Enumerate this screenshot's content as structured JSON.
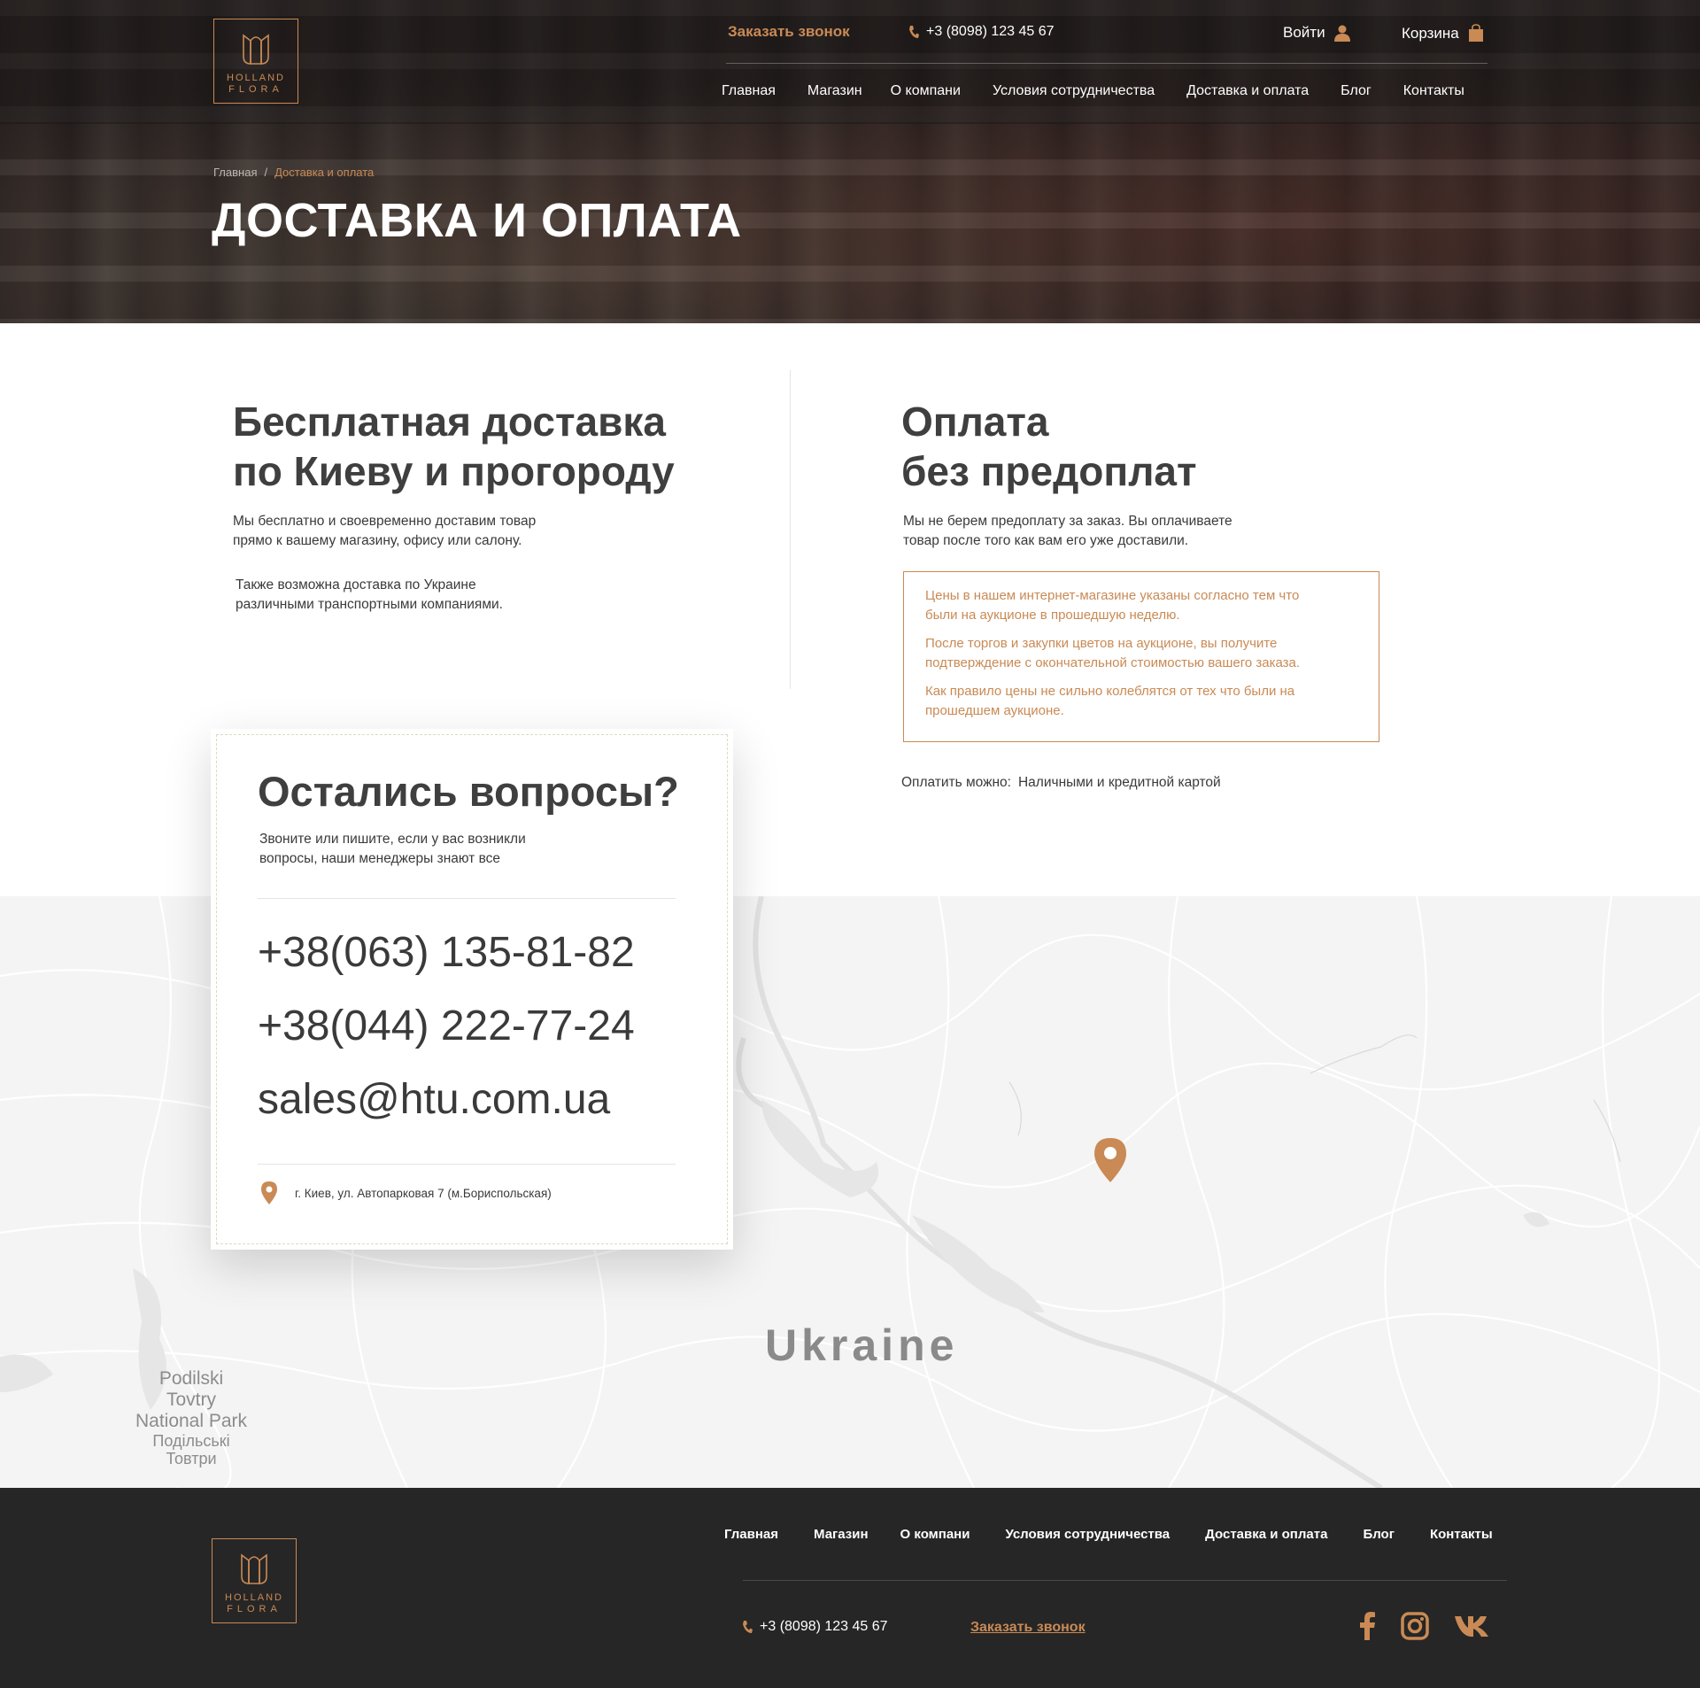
{
  "brand": {
    "line1": "HOLLAND",
    "line2": "FLORA",
    "accent": "#c98a55",
    "dark": "#262626"
  },
  "header": {
    "callback": "Заказать звонок",
    "phone": "+3 (8098) 123 45 67",
    "login": "Войти",
    "cart": "Корзина",
    "nav": [
      "Главная",
      "Магазин",
      "О компани",
      "Условия сотрудничества",
      "Доставка и оплата",
      "Блог",
      "Контакты"
    ]
  },
  "breadcrumb": {
    "home": "Главная",
    "separator": "/",
    "current": "Доставка и оплата"
  },
  "page_title": "ДОСТАВКА И ОПЛАТА",
  "delivery": {
    "title_line1": "Бесплатная доставка",
    "title_line2": "по Киеву и прогороду",
    "text1_line1": "Мы бесплатно и своевременно доставим товар",
    "text1_line2": "прямо к вашему магазину, офису или салону.",
    "text2_line1": "Также возможна доставка по Украине",
    "text2_line2": "различными транспортными компаниями."
  },
  "payment": {
    "title_line1": "Оплата",
    "title_line2": "без предоплат",
    "text_line1": "Мы не берем предоплату за заказ. Вы оплачиваете",
    "text_line2": "товар после того как вам его уже доставили.",
    "notes": [
      {
        "l1": "Цены в нашем интернет-магазине указаны согласно тем что",
        "l2": "были на аукционе в прошедшую неделю."
      },
      {
        "l1": "После торгов и закупки цветов на аукционе, вы получите",
        "l2": "подтверждение с окончательной стоимостью вашего заказа."
      },
      {
        "l1": "Как правило цены не сильно колеблятся от тех  что были на",
        "l2": "прошедшем аукционе."
      }
    ],
    "pay_label": "Оплатить можно:",
    "pay_methods": "Наличными и кредитной картой"
  },
  "contact_card": {
    "title": "Остались вопросы?",
    "sub_line1": "Звоните или пишите,  если у вас возникли",
    "sub_line2": "вопросы, наши менеджеры знают все",
    "phone1": "+38(063) 135-81-82",
    "phone2": "+38(044) 222-77-24",
    "email": "sales@htu.com.ua",
    "address": "г. Киев, ул. Автопарковая 7 (м.Бориспольская)"
  },
  "map": {
    "country": "Ukraine",
    "park_line1": "Podilski",
    "park_line2": "Tovtry",
    "park_line3": "National Park",
    "park_ua1": "Подільські",
    "park_ua2": "Товтри"
  },
  "footer": {
    "nav": [
      "Главная",
      "Магазин",
      "О компани",
      "Условия сотрудничества",
      "Доставка и оплата",
      "Блог",
      "Контакты"
    ],
    "phone": "+3 (8098) 123 45 67",
    "callback": "Заказать звонок",
    "socials": [
      "facebook-icon",
      "instagram-icon",
      "vk-icon"
    ]
  }
}
